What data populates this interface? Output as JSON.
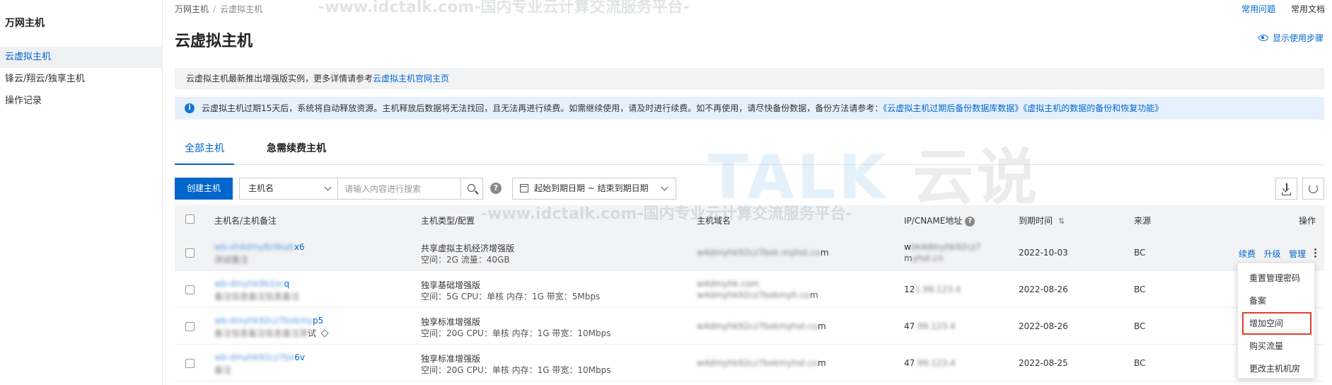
{
  "sidebar": {
    "title": "万网主机",
    "items": [
      {
        "label": "云虚拟主机",
        "active": true
      },
      {
        "label": "锋云/翔云/独享主机",
        "active": false
      },
      {
        "label": "操作记录",
        "active": false
      }
    ]
  },
  "breadcrumb": {
    "root": "万网主机",
    "separator": "/",
    "current": "云虚拟主机"
  },
  "top_links": {
    "faq": "常用问题",
    "docs": "常用文档"
  },
  "page_title": "云虚拟主机",
  "show_steps": "显示使用步骤",
  "notice_primary": {
    "text": "云虚拟主机最新推出增强版实例，更多详情请参考",
    "link": "云虚拟主机官网主页"
  },
  "notice_info": {
    "icon": "i",
    "text": "云虚拟主机过期15天后，系统将自动释放资源。主机释放后数据将无法找回，且无法再进行续费。如需继续使用，请及时进行续费。如不再使用，请尽快备份数据，备份方法请参考：",
    "links": [
      "《云虚拟主机过期后备份数据库数据》",
      "《虚拟主机的数据的备份和恢复功能》"
    ]
  },
  "tabs": [
    {
      "label": "全部主机",
      "active": true
    },
    {
      "label": "急需续费主机",
      "active": false
    }
  ],
  "toolbar": {
    "create_label": "创建主机",
    "search_field": "主机名",
    "search_placeholder": "请输入内容进行搜索",
    "help": "?",
    "date_range": "起始到期日期 ~ 结束到期日期"
  },
  "table": {
    "headers": {
      "name": "主机名/主机备注",
      "type": "主机类型/配置",
      "domain": "主机域名",
      "ip": "IP/CNAME地址",
      "ip_help": "?",
      "expire": "到期时间",
      "expire_sort": "⇅",
      "source": "来源",
      "ops": "操作"
    },
    "rows": [
      {
        "name_l1": "x6",
        "type_l1": "共享虚拟主机经济增强版",
        "type_l2": "空间：2G 流量：40GB",
        "domain_suffix": "m",
        "ip_l1": "w",
        "ip_l2": "m",
        "expire": "2022-10-03",
        "source": "BC"
      },
      {
        "name_l1": "q",
        "type_l1": "独享基础增强版",
        "type_l2": "空间：5G CPU：单核 内存：1G 带宽：5Mbps",
        "domain_suffix": "m",
        "ip_l1": "12",
        "ip_l2": "",
        "expire": "2022-08-26",
        "source": "BC"
      },
      {
        "name_l1": "p5",
        "name_l2": "试",
        "type_l1": "独享标准增强版",
        "type_l2": "空间：20G CPU：单核 内存：1G 带宽：10Mbps",
        "domain_suffix": "m",
        "ip_l1": "47",
        "ip_l2": "",
        "expire": "2022-08-26",
        "source": "BC"
      },
      {
        "name_l1": "6v",
        "type_l1": "独享标准增强版",
        "type_l2": "空间：20G CPU：单核 内存：1G 带宽：10Mbps",
        "domain_suffix": "m",
        "ip_l1": "47",
        "ip_l2": "",
        "expire": "2022-08-25",
        "source": "BC"
      }
    ],
    "row_ops": {
      "renew": "续费",
      "upgrade": "升级",
      "manage": "管理",
      "renew_short": "续"
    }
  },
  "more_menu": {
    "items": [
      "重置管理密码",
      "备案",
      "增加空间",
      "购买流量",
      "更改主机机房"
    ],
    "highlighted": "增加空间"
  },
  "watermark": {
    "url_text": "-www.idctalk.com-国内专业云计算交流服务平台-",
    "logo_text": "TALK",
    "logo_cn": "云说"
  },
  "colors": {
    "accent": "#0066cc",
    "highlight": "#e33f2b",
    "notice_bg": "#e7f1fd"
  }
}
